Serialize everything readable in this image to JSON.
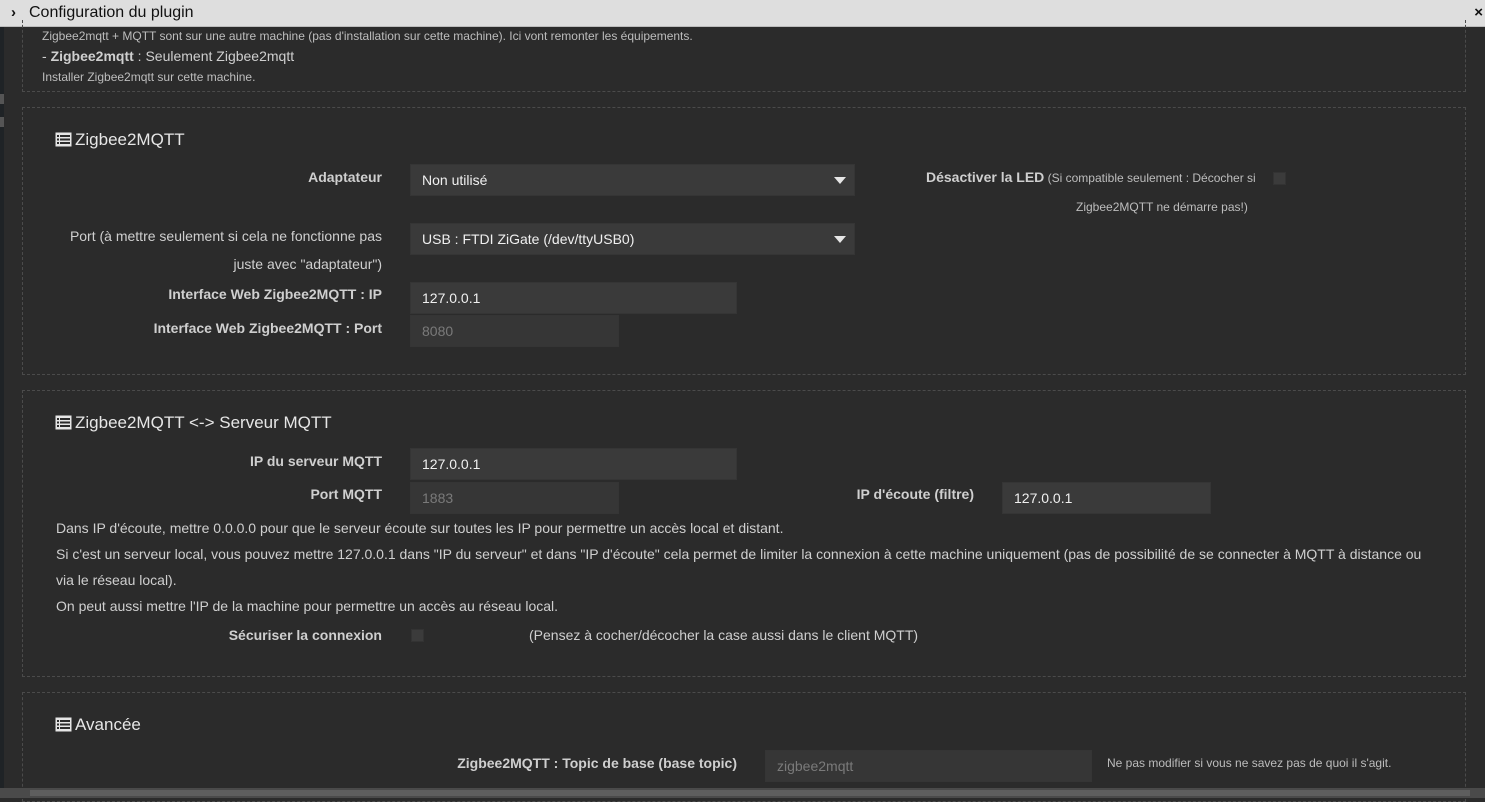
{
  "window": {
    "title": "Configuration du plugin"
  },
  "intro": {
    "line1": "Zigbee2mqtt + MQTT sont sur une autre machine (pas d'installation sur cette machine). Ici vont remonter les équipements.",
    "opt_prefix": "- ",
    "opt_bold": "Zigbee2mqtt",
    "opt_rest": " : Seulement Zigbee2mqtt",
    "line3": "Installer Zigbee2mqtt sur cette machine."
  },
  "zigbee": {
    "legend": "Zigbee2MQTT",
    "adapter_label": "Adaptateur",
    "adapter_value": "Non utilisé",
    "led_label": "Désactiver la LED",
    "led_note": " (Si compatible seulement : Décocher si",
    "led_note2": "Zigbee2MQTT ne démarre pas!)",
    "port_label1": "Port (à mettre seulement si cela ne fonctionne pas",
    "port_label2": "juste avec \"adaptateur\")",
    "port_value": "USB : FTDI ZiGate (/dev/ttyUSB0)",
    "web_ip_label": "Interface Web Zigbee2MQTT : IP",
    "web_ip_value": "127.0.0.1",
    "web_port_label": "Interface Web Zigbee2MQTT : Port",
    "web_port_placeholder": "8080"
  },
  "mqtt": {
    "legend": "Zigbee2MQTT <-> Serveur MQTT",
    "ip_label": "IP du serveur MQTT",
    "ip_value": "127.0.0.1",
    "port_label": "Port MQTT",
    "port_placeholder": "1883",
    "listen_label": "IP d'écoute (filtre)",
    "listen_value": "127.0.0.1",
    "help1": "Dans IP d'écoute, mettre 0.0.0.0 pour que le serveur écoute sur toutes les IP pour permettre un accès local et distant.",
    "help2": "Si c'est un serveur local, vous pouvez mettre 127.0.0.1 dans \"IP du serveur\" et dans \"IP d'écoute\" cela permet de limiter la connexion à cette machine uniquement (pas de possibilité de se connecter à MQTT à distance ou",
    "help3": "via le réseau local).",
    "help4": "On peut aussi mettre l'IP de la machine pour permettre un accès au réseau local.",
    "secure_label": "Sécuriser la connexion",
    "secure_note": "(Pensez à cocher/décocher la case aussi dans le client MQTT)"
  },
  "advanced": {
    "legend": "Avancée",
    "topic_label": "Zigbee2MQTT : Topic de base (base topic)",
    "topic_placeholder": "zigbee2mqtt",
    "topic_note": "Ne pas modifier si vous ne savez pas de quoi il s'agit."
  },
  "icons": {
    "chevron": "chevron-right-icon",
    "close": "close-icon",
    "section": "list-alt-icon"
  }
}
